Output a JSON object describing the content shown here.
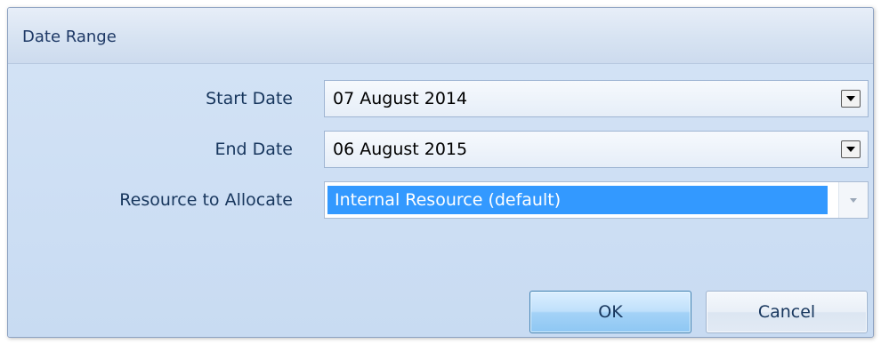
{
  "dialog": {
    "title": "Date Range"
  },
  "form": {
    "start_date": {
      "label": "Start Date",
      "value": "07 August 2014"
    },
    "end_date": {
      "label": "End Date",
      "value": "06 August 2015"
    },
    "resource": {
      "label": "Resource to Allocate",
      "value": "Internal Resource (default)"
    }
  },
  "buttons": {
    "ok_label": "OK",
    "cancel_label": "Cancel"
  },
  "colors": {
    "dialog_bg": "#cfe0f4",
    "selection": "#3399ff",
    "label_text": "#17365d"
  },
  "icons": {
    "start_dropdown": "chevron-down-icon",
    "end_dropdown": "chevron-down-icon",
    "resource_dropdown": "chevron-down-icon"
  }
}
